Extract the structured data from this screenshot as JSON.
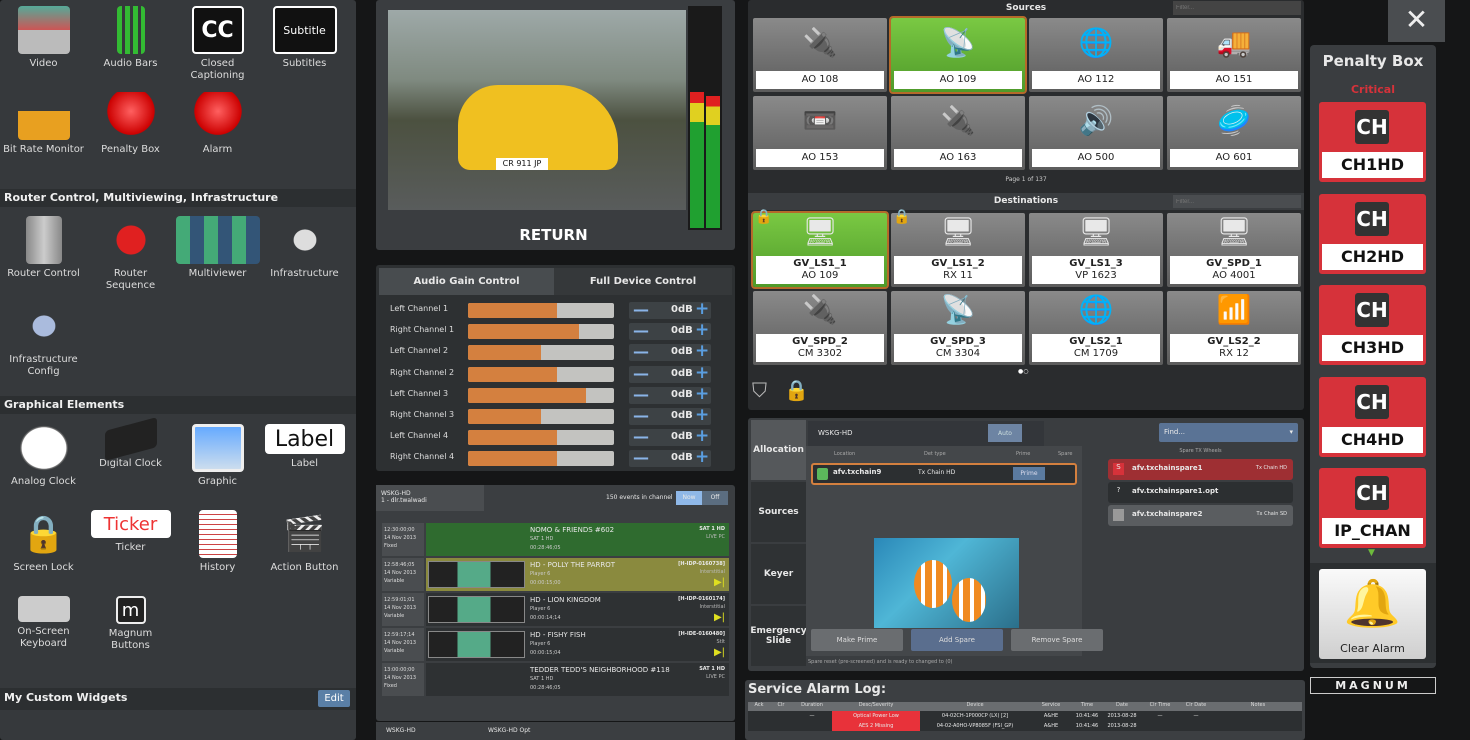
{
  "palette": {
    "row1": [
      {
        "label": "Video",
        "icon": "video-icon"
      },
      {
        "label": "Audio Bars",
        "icon": "audio-bars-icon"
      },
      {
        "label": "Closed Captioning",
        "icon": "cc-icon",
        "glyph": "CC"
      },
      {
        "label": "Subtitles",
        "icon": "subtitle-icon",
        "glyph": "Subtitle"
      },
      {
        "label": "Bit Rate Monitor",
        "icon": "bitrate-icon"
      },
      {
        "label": "Penalty Box",
        "icon": "beacon-icon"
      },
      {
        "label": "Alarm",
        "icon": "beacon-icon"
      }
    ],
    "section_router": "Router Control, Multiviewing, Infrastructure",
    "row2": [
      {
        "label": "Router Control",
        "icon": "router-icon"
      },
      {
        "label": "Router Sequence",
        "icon": "red-dot-icon"
      },
      {
        "label": "Multiviewer",
        "icon": "multiviewer-icon"
      },
      {
        "label": "Infrastructure",
        "icon": "infrastructure-icon"
      },
      {
        "label": "Infrastructure Config",
        "icon": "infrastructure-config-icon"
      }
    ],
    "section_graphical": "Graphical Elements",
    "row3": [
      {
        "label": "Analog Clock",
        "icon": "analog-clock-icon"
      },
      {
        "label": "Digital Clock",
        "icon": "digital-clock-icon"
      },
      {
        "label": "Graphic",
        "icon": "graphic-icon"
      },
      {
        "label": "Label",
        "icon": "label-icon",
        "glyph": "Label"
      },
      {
        "label": "Screen Lock",
        "icon": "lock-icon"
      },
      {
        "label": "Ticker",
        "icon": "ticker-icon",
        "glyph": "Ticker"
      },
      {
        "label": "History",
        "icon": "history-icon"
      },
      {
        "label": "Action Button",
        "icon": "clapper-icon"
      },
      {
        "label": "On-Screen Keyboard",
        "icon": "keyboard-icon"
      },
      {
        "label": "Magnum Buttons",
        "icon": "magnum-button-icon"
      }
    ],
    "section_custom": "My Custom Widgets",
    "edit_label": "Edit"
  },
  "preview": {
    "label": "RETURN",
    "plate": "CR 911 JP",
    "meter_levels": [
      0.62,
      0.6
    ]
  },
  "audio": {
    "tabs": [
      "Audio Gain Control",
      "Full Device Control"
    ],
    "channels": [
      {
        "label": "Left Channel 1",
        "level": 0.61,
        "value": "0dB"
      },
      {
        "label": "Right Channel 1",
        "level": 0.76,
        "value": "0dB"
      },
      {
        "label": "Left Channel 2",
        "level": 0.5,
        "value": "0dB"
      },
      {
        "label": "Right Channel 2",
        "level": 0.61,
        "value": "0dB"
      },
      {
        "label": "Left Channel 3",
        "level": 0.81,
        "value": "0dB"
      },
      {
        "label": "Right Channel 3",
        "level": 0.5,
        "value": "0dB"
      },
      {
        "label": "Left Channel 4",
        "level": 0.61,
        "value": "0dB"
      },
      {
        "label": "Right Channel 4",
        "level": 0.61,
        "value": "0dB"
      }
    ]
  },
  "playlist": {
    "channel": "WSKG-HD",
    "sub": "1 - dlr.twalwadi",
    "count": "150 events in channel",
    "toggle": [
      "Now",
      "Off"
    ],
    "events": [
      {
        "time": "12:30:00;00",
        "date": "14 Nov 2013",
        "type": "Fixed",
        "title": "NOMO & FRIENDS #602",
        "sub": "SAT 1 HD",
        "dur": "00:28:46;05",
        "id": "SAT 1 HD",
        "extra": "LIVE PC",
        "color": "#2f6b2f"
      },
      {
        "time": "12:58:46;05",
        "date": "14 Nov 2013",
        "type": "Variable",
        "title": "HD - POLLY THE PARROT",
        "sub": "Player 6",
        "dur": "00:00:15;00",
        "id": "[H-IDP-0160738]",
        "extra": "Interstitial",
        "color": "#8a8a3e"
      },
      {
        "time": "12:59:01;01",
        "date": "14 Nov 2013",
        "type": "Variable",
        "title": "HD - LION KINGDOM",
        "sub": "Player 6",
        "dur": "00:00:14;14",
        "id": "[H-IDP-0160174]",
        "extra": "Interstitial",
        "color": "#2e3133"
      },
      {
        "time": "12:59:17;14",
        "date": "14 Nov 2013",
        "type": "Variable",
        "title": "HD - FISHY FISH",
        "sub": "Player 6",
        "dur": "00:00:15;04",
        "id": "[H-IDE-0160480]",
        "extra": "Stlt",
        "color": "#2e3133"
      },
      {
        "time": "13:00:00;00",
        "date": "14 Nov 2013",
        "type": "Fixed",
        "title": "TEDDER TEDD'S NEIGHBORHOOD #118",
        "sub": "SAT 1 HD",
        "dur": "00:28:46;05",
        "id": "SAT 1 HD",
        "extra": "LIVE PC",
        "color": "#2e3133"
      }
    ],
    "footer_left": "WSKG-HD",
    "footer_right": "WSKG-HD Opt"
  },
  "sources": {
    "title": "Sources",
    "filter_placeholder": "Filter...",
    "page": "Page 1 of 137",
    "items": [
      {
        "label": "AO 108",
        "icon": "connector-icon",
        "glyph": "🔌"
      },
      {
        "label": "AO 109",
        "icon": "satellite-dish-icon",
        "glyph": "📡",
        "selected": true
      },
      {
        "label": "AO 112",
        "icon": "globe-icon",
        "glyph": "🌐"
      },
      {
        "label": "AO 151",
        "icon": "truck-icon",
        "glyph": "🚚"
      },
      {
        "label": "AO 153",
        "icon": "vhs-tape-icon",
        "glyph": "📼"
      },
      {
        "label": "AO 163",
        "icon": "connector-icon",
        "glyph": "🔌"
      },
      {
        "label": "AO 500",
        "icon": "speaker-icon",
        "glyph": "🔊"
      },
      {
        "label": "AO 601",
        "icon": "dish-speaker-icon",
        "glyph": "🥏"
      }
    ]
  },
  "destinations": {
    "title": "Destinations",
    "filter_placeholder": "Filter...",
    "items": [
      {
        "name": "GV_LS1_1",
        "src": "AO 109",
        "icon": "monitor-icon",
        "glyph": "🖥",
        "selected": true,
        "locked": true
      },
      {
        "name": "GV_LS1_2",
        "src": "RX 11",
        "icon": "monitor-icon",
        "glyph": "🖥",
        "locked": true
      },
      {
        "name": "GV_LS1_3",
        "src": "VP 1623",
        "icon": "monitor-icon",
        "glyph": "🖥"
      },
      {
        "name": "GV_SPD_1",
        "src": "AO 4001",
        "icon": "monitor-icon",
        "glyph": "🖥"
      },
      {
        "name": "GV_SPD_2",
        "src": "CM 3302",
        "icon": "connector-icon",
        "glyph": "🔌"
      },
      {
        "name": "GV_SPD_3",
        "src": "CM 3304",
        "icon": "satellite-dish-icon",
        "glyph": "📡"
      },
      {
        "name": "GV_LS2_1",
        "src": "CM 1709",
        "icon": "globe-icon",
        "glyph": "🌐"
      },
      {
        "name": "GV_LS2_2",
        "src": "RX 12",
        "icon": "antenna-icon",
        "glyph": "📶"
      }
    ]
  },
  "allocation": {
    "tabs": [
      "Allocation",
      "Sources",
      "Keyer",
      "Emergency Slide"
    ],
    "channel": "WSKG-HD",
    "auto": "Auto",
    "find": "Find...",
    "cols": [
      "Location",
      "Det type",
      "Prime",
      "Spare"
    ],
    "spare_header": "Spare TX Wheels",
    "prime": {
      "name": "afv.txchain9",
      "type": "Tx Chain HD",
      "action": "Prime"
    },
    "spares": [
      {
        "badge": "S",
        "name": "afv.txchainspare1",
        "type": "Tx Chain HD"
      },
      {
        "badge": "?",
        "name": "afv.txchainspare1.opt",
        "type": ""
      },
      {
        "badge": "",
        "name": "afv.txchainspare2",
        "type": "Tx Chain SD"
      }
    ],
    "buttons": [
      "Make Prime",
      "Add Spare",
      "Remove Spare"
    ],
    "status": "Spare reset (pre-screened) and is ready to changed to (0)"
  },
  "alarm": {
    "title": "Service Alarm Log:",
    "cols": [
      "Ack",
      "Clr",
      "Duration",
      "Desc/Severity",
      "Device",
      "Service",
      "Time",
      "Date",
      "Clr Time",
      "Clr Date",
      "Notes"
    ],
    "rows": [
      [
        "",
        "",
        "—",
        "Optical Power Low",
        "04-02CH-1P000CP (LX) [2]",
        "A&HE",
        "10:41:46",
        "2013-08-28",
        "—",
        "—",
        ""
      ],
      [
        "",
        "",
        "",
        "AES 2 Missing",
        "04-02-A0HO-VP8085F (FSI_GP)",
        "A&HE",
        "10:41:46",
        "2013-08-28",
        "",
        "",
        ""
      ]
    ]
  },
  "penalty": {
    "title": "Penalty Box",
    "severity": "Critical",
    "channels": [
      "CH1HD",
      "CH2HD",
      "CH3HD",
      "CH4HD",
      "IP_CHAN"
    ],
    "logo_glyph": "CH",
    "clear": "Clear Alarm"
  },
  "brand": "MAGNUM",
  "colors": {
    "accent_orange": "#d4803f",
    "critical": "#d6323a",
    "selected_green": "#6dbb3c",
    "plus_blue": "#5a9ee0"
  }
}
